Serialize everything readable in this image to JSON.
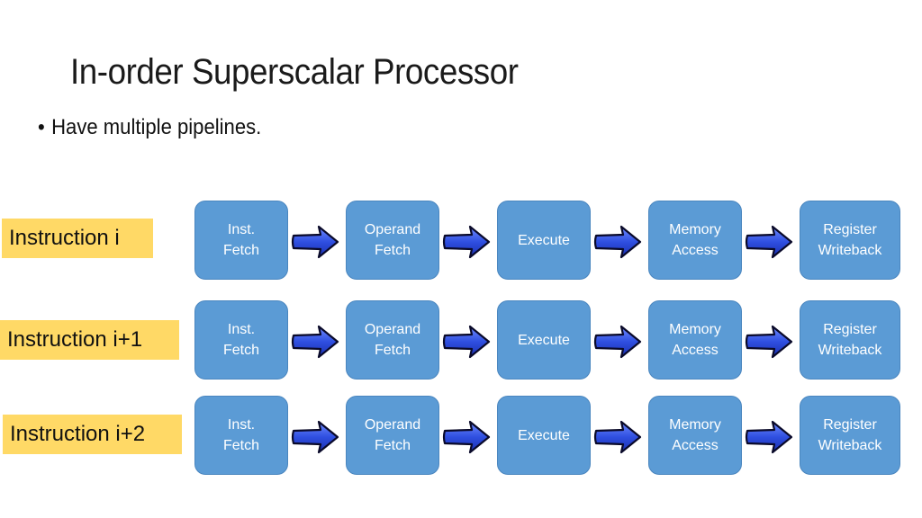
{
  "slide": {
    "title": "In-order Superscalar Processor",
    "bullets": [
      "Have multiple pipelines."
    ]
  },
  "colors": {
    "stage_fill": "#5b9bd5",
    "label_fill": "#ffd966",
    "arrow_fill": "#2f4fe0",
    "arrow_outline": "#0a0a2a"
  },
  "rows": [
    {
      "label": "Instruction i",
      "stages": [
        "Inst.\nFetch",
        "Operand\nFetch",
        "Execute",
        "Memory\nAccess",
        "Register\nWriteback"
      ]
    },
    {
      "label": "Instruction i+1",
      "stages": [
        "Inst.\nFetch",
        "Operand\nFetch",
        "Execute",
        "Memory\nAccess",
        "Register\nWriteback"
      ]
    },
    {
      "label": "Instruction i+2",
      "stages": [
        "Inst.\nFetch",
        "Operand\nFetch",
        "Execute",
        "Memory\nAccess",
        "Register\nWriteback"
      ]
    }
  ]
}
